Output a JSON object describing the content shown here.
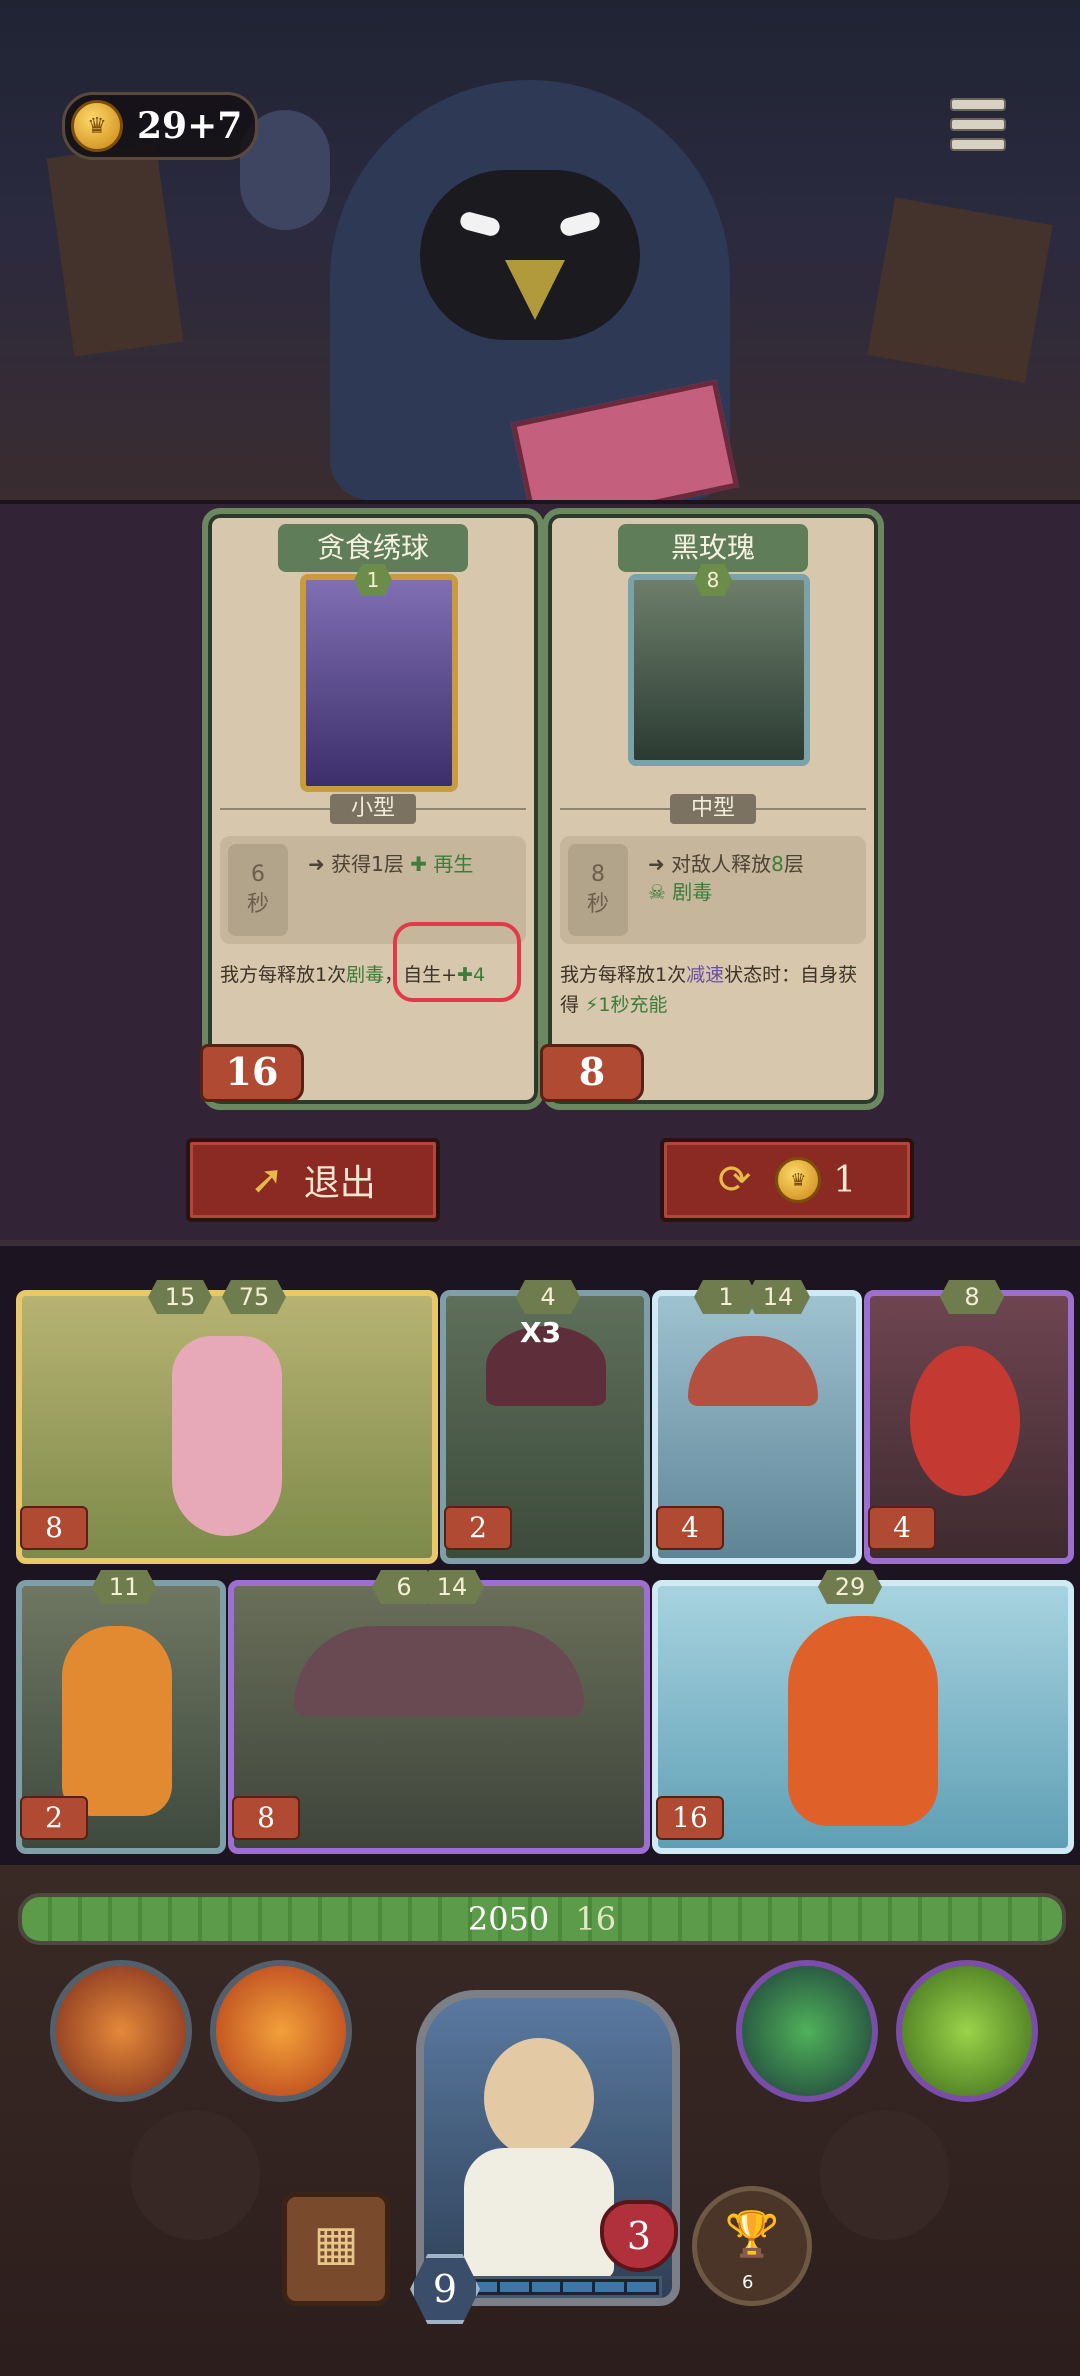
{
  "header": {
    "coins": "29+7",
    "coin_icon": "crown-coin-icon",
    "menu_icon": "menu-icon"
  },
  "shop": {
    "cards": [
      {
        "title": "贪食绣球",
        "level": "1",
        "size": "小型",
        "timer_value": "6",
        "timer_unit": "秒",
        "effect_prefix": "获得1层",
        "effect_keyword": "再生",
        "desc_part1": "我方每释放1次",
        "desc_keyword": "剧毒",
        "desc_part2": "，自生+",
        "desc_value": "4",
        "price": "16"
      },
      {
        "title": "黑玫瑰",
        "level": "8",
        "size": "中型",
        "timer_value": "8",
        "timer_unit": "秒",
        "effect_prefix": "对敌人释放",
        "effect_count": "8",
        "effect_suffix": "层",
        "effect_keyword": "剧毒",
        "desc_part1": "我方每释放1次",
        "desc_keyword": "减速",
        "desc_part2": "状态时：自身获得",
        "desc_value": "1秒充能",
        "price": "8"
      }
    ],
    "exit_label": "退出",
    "reroll_cost": "1"
  },
  "board": {
    "row1": [
      {
        "name": "flower-fairy",
        "stats": [
          "15",
          "75"
        ],
        "tag": "8"
      },
      {
        "name": "witch-hat-kid",
        "stats": [
          "4"
        ],
        "multiplier": "X3",
        "tag": "2"
      },
      {
        "name": "mushroom-creature",
        "stats": [
          "1",
          "14"
        ],
        "tag": "4"
      },
      {
        "name": "red-imp",
        "stats": [
          "8"
        ],
        "tag": "4"
      }
    ],
    "row2": [
      {
        "name": "orange-girl",
        "stats": [
          "11"
        ],
        "tag": "2"
      },
      {
        "name": "tree-mushroom",
        "stats": [
          "6",
          "14"
        ],
        "tag": "8"
      },
      {
        "name": "fire-fairy",
        "stats": [
          "29"
        ],
        "tag": "16"
      }
    ]
  },
  "hud": {
    "health": "2050",
    "shield": "16",
    "hero_level": "9",
    "lives": "3",
    "trophies": "6",
    "skills": [
      "fire-fist-icon",
      "flame-icon",
      "poison-cloud-icon",
      "green-slime-icon"
    ]
  }
}
